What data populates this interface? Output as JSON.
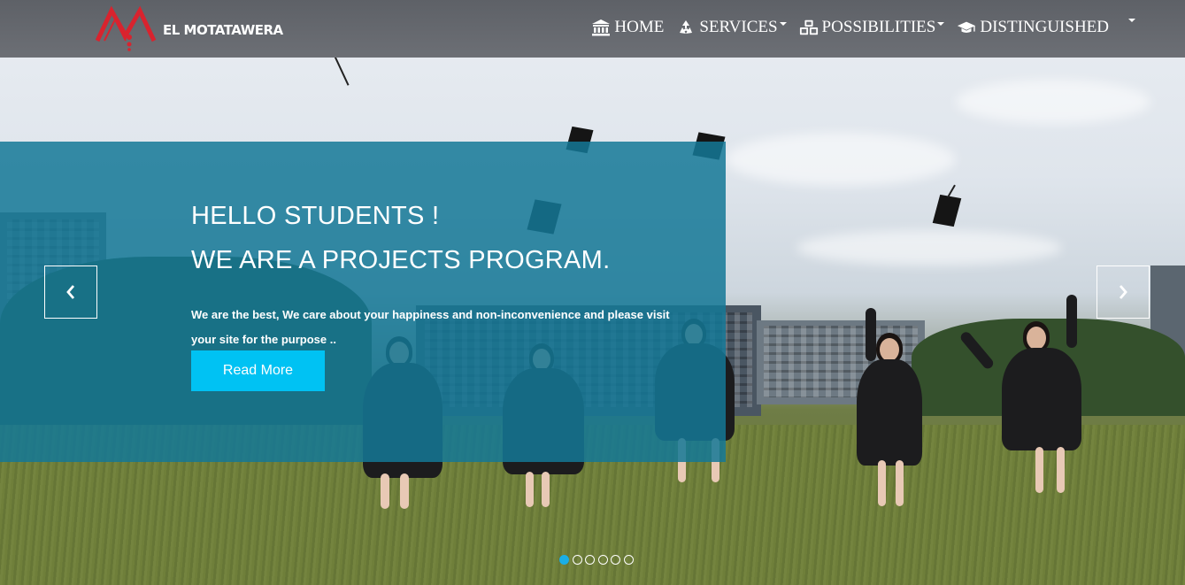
{
  "brand": {
    "name": "EL MOTATAWERA",
    "logo_color": "#d9232e"
  },
  "nav": {
    "items": [
      {
        "label": "HOME",
        "icon": "bank-icon",
        "dropdown": false
      },
      {
        "label": "SERVICES",
        "icon": "recycle-icon",
        "dropdown": true
      },
      {
        "label": "POSSIBILITIES",
        "icon": "cubes-icon",
        "dropdown": true
      },
      {
        "label": "DISTINGUISHED",
        "icon": "graduation-cap-icon",
        "dropdown": false
      }
    ],
    "toggle_icon": "caret-down-icon"
  },
  "hero": {
    "title_line1": "HELLO STUDENTS !",
    "title_line2": "WE ARE A PROJECTS PROGRAM.",
    "text": "We are the best, We care about your happiness and non-inconvenience and please visit your site for the purpose ..",
    "button_label": "Read More",
    "panel_color": "#1478967",
    "button_color": "#00c2f3"
  },
  "carousel": {
    "prev_icon": "chevron-left-icon",
    "next_icon": "chevron-right-icon",
    "slide_count": 6,
    "active_index": 0,
    "active_color": "#1aaee6"
  }
}
